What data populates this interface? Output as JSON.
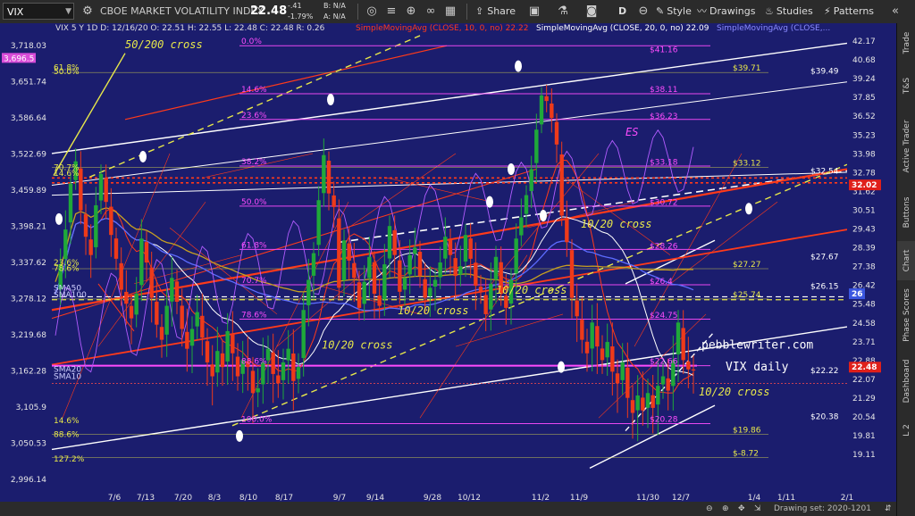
{
  "toolbar": {
    "symbol": "VIX",
    "fullname": "CBOE MARKET VOLATILITY INDEX",
    "last": "22.48",
    "change": "-.41",
    "change_pct": "-1.79%",
    "bid": "B: N/A",
    "ask": "A: N/A",
    "share_label": "Share",
    "style_label": "Style",
    "drawings_label": "Drawings",
    "studies_label": "Studies",
    "patterns_label": "Patterns",
    "aggregation": "D"
  },
  "legend": {
    "ohlc": "VIX 5 Y 1D  D: 12/16/20  O: 22.51  H: 22.55  L: 22.48  C: 22.48  R: 0.26",
    "sma10": "SimpleMovingAvg (CLOSE, 10, 0, no) 22.22",
    "sma20": "SimpleMovingAvg (CLOSE, 20, 0, no) 22.09",
    "sma_more": "SimpleMovingAvg (CLOSE,..."
  },
  "right_panel": {
    "tabs": [
      "Trade",
      "T&S",
      "Active Trader",
      "Buttons",
      "Chart",
      "Phase Scores",
      "Dashboard",
      "L 2"
    ]
  },
  "bottom_bar": {
    "drawing_set": "Drawing set: 2020-1201"
  },
  "colors": {
    "background": "#1b1d6e",
    "up_candle": "#1fa83a",
    "down_candle": "#ee3a1a",
    "fib_magenta": "#ff4cff",
    "fib_yellow": "#e8e84a",
    "trend_white": "#ffffff",
    "trend_red": "#ff3a1a"
  },
  "chart_data": {
    "type": "candlestick",
    "title": "VIX daily",
    "watermark": "pebblewriter.com",
    "x_tick_labels": [
      "7/6",
      "7/13",
      "7/20",
      "8/3",
      "8/10",
      "8/17",
      "9/7",
      "9/14",
      "9/28",
      "10/12",
      "11/2",
      "11/9",
      "11/30",
      "12/7",
      "1/4",
      "1/11",
      "2/1"
    ],
    "left_axis_labels": [
      "3,718.03",
      "3,651.74",
      "3,586.64",
      "3,522.69",
      "3,459.89",
      "3,398.21",
      "3,337.62",
      "3,278.12",
      "3,219.68",
      "3,162.28",
      "3,105.9",
      "3,050.53",
      "2,996.14"
    ],
    "left_axis_badge": "3,696.5",
    "right_axis_labels": [
      "42.17",
      "40.68",
      "39.24",
      "37.85",
      "36.52",
      "35.23",
      "33.98",
      "32.78",
      "31.62",
      "30.51",
      "29.43",
      "28.39",
      "27.38",
      "26.42",
      "25.48",
      "24.58",
      "23.71",
      "22.88",
      "22.07",
      "21.29",
      "20.54",
      "19.81",
      "19.11"
    ],
    "right_axis_badges": [
      {
        "label": "32.02",
        "color": "#e0201a"
      },
      {
        "label": "26",
        "color": "#3a56e0"
      },
      {
        "label": "22.48",
        "color": "#e0201a"
      },
      {
        "label": "22.22",
        "color": "#c02a6a"
      },
      {
        "label": "22.09",
        "color": "#888888"
      }
    ],
    "fib_levels_left": [
      {
        "label": "0.0%",
        "value": 41.8
      },
      {
        "label": "14.6%",
        "value": 38.12
      },
      {
        "label": "23.6%",
        "value": 36.3
      },
      {
        "label": "38.2%",
        "value": 33.2
      },
      {
        "label": "50.0%",
        "value": 30.75
      },
      {
        "label": "61.8%",
        "value": 28.3
      },
      {
        "label": "70.7%",
        "value": 26.45
      },
      {
        "label": "78.6%",
        "value": 24.76
      },
      {
        "label": "88.6%",
        "value": 22.66
      },
      {
        "label": "100.0%",
        "value": 20.28
      }
    ],
    "fib_prices_right": [
      {
        "label": "$41.16",
        "value": 41.16
      },
      {
        "label": "$38.11",
        "value": 38.11
      },
      {
        "label": "$36.23",
        "value": 36.23
      },
      {
        "label": "$33.18",
        "value": 33.18
      },
      {
        "label": "$30.72",
        "value": 30.72
      },
      {
        "label": "$28.26",
        "value": 28.26
      },
      {
        "label": "$26.4",
        "value": 26.4
      },
      {
        "label": "$24.75",
        "value": 24.75
      },
      {
        "label": "$22.66",
        "value": 22.66
      },
      {
        "label": "$20.28",
        "value": 20.28
      }
    ],
    "yellow_fib_labels_left": [
      {
        "label": "61.8%",
        "value": 40.1
      },
      {
        "label": "50.0%",
        "value": 39.8
      },
      {
        "label": "70.7%",
        "value": 33.1
      },
      {
        "label": "14.6%",
        "value": 32.75
      },
      {
        "label": "23.6%",
        "value": 27.6
      },
      {
        "label": "78.6%",
        "value": 27.3
      },
      {
        "label": "14.6%",
        "value": 20.4
      },
      {
        "label": "88.6%",
        "value": 19.86
      },
      {
        "label": "127.2%",
        "value": 18.95
      }
    ],
    "price_labels": [
      {
        "label": "$39.71",
        "value": 39.71
      },
      {
        "label": "$33.12",
        "value": 33.12
      },
      {
        "label": "$27.27",
        "value": 27.27
      },
      {
        "label": "$25.74",
        "value": 25.74
      },
      {
        "label": "$19.86",
        "value": 19.86
      },
      {
        "label": "$-8.72",
        "value": 19.0
      }
    ],
    "level_labels_white": [
      {
        "label": "$39.49",
        "value": 39.49
      },
      {
        "label": "$27.67",
        "value": 27.67
      },
      {
        "label": "$20.38",
        "value": 20.38
      },
      {
        "label": "$32.54",
        "value": 32.6
      },
      {
        "label": "$26.15",
        "value": 26.15
      },
      {
        "label": "$22.22",
        "value": 22.25
      }
    ],
    "sma_labels": [
      {
        "label": "SMA50",
        "value": 26.3
      },
      {
        "label": "SMA100",
        "value": 25.95
      },
      {
        "label": "SMA20",
        "value": 22.5
      },
      {
        "label": "SMA10",
        "value": 22.2
      }
    ],
    "annotations": [
      {
        "text": "50/200 cross",
        "color": "#e8e84a"
      },
      {
        "text": "10/20 cross",
        "color": "#e8e84a"
      },
      {
        "text": "10/20 cross",
        "color": "#e8e84a"
      },
      {
        "text": "10/20 cross",
        "color": "#e8e84a"
      },
      {
        "text": "10/20 cross",
        "color": "#e8e84a"
      },
      {
        "text": "10/20 cross",
        "color": "#e8e84a"
      },
      {
        "text": "ES",
        "color": "#ff4cff"
      }
    ],
    "ylim_vix": [
      19.1,
      42.6
    ],
    "close_series": [
      26.0,
      27.5,
      29.4,
      32.1,
      33.5,
      30.5,
      29.0,
      28.0,
      30.8,
      32.7,
      31.0,
      29.1,
      27.8,
      26.2,
      25.5,
      24.8,
      26.0,
      28.9,
      27.6,
      25.8,
      24.5,
      23.8,
      25.4,
      26.8,
      25.6,
      24.3,
      23.4,
      24.3,
      25.1,
      23.9,
      22.8,
      22.2,
      23.3,
      22.6,
      24.2,
      23.2,
      22.2,
      22.9,
      22.6,
      21.5,
      21.7,
      22.8,
      23.4,
      22.3,
      21.9,
      22.8,
      23.4,
      22.0,
      22.6,
      25.2,
      26.7,
      28.1,
      31.1,
      33.9,
      31.5,
      30.7,
      26.3,
      28.8,
      27.7,
      26.8,
      25.3,
      26.6,
      27.9,
      26.0,
      25.4,
      27.5,
      29.6,
      28.0,
      26.1,
      26.8,
      28.0,
      28.4,
      26.9,
      25.8,
      26.3,
      26.7,
      27.6,
      29.0,
      28.0,
      26.9,
      27.4,
      29.1,
      27.8,
      26.4,
      26.1,
      25.0,
      26.5,
      27.9,
      26.0,
      25.3,
      26.7,
      28.9,
      30.1,
      31.4,
      33.0,
      35.6,
      38.0,
      37.6,
      36.4,
      34.6,
      30.2,
      28.7,
      25.8,
      24.9,
      23.8,
      23.2,
      24.6,
      23.5,
      22.9,
      23.7,
      22.4,
      21.9,
      22.8,
      21.3,
      20.7,
      21.4,
      20.8,
      21.5,
      20.9,
      21.8,
      22.2,
      21.6,
      22.9,
      24.6,
      22.9,
      22.5,
      22.48
    ]
  }
}
